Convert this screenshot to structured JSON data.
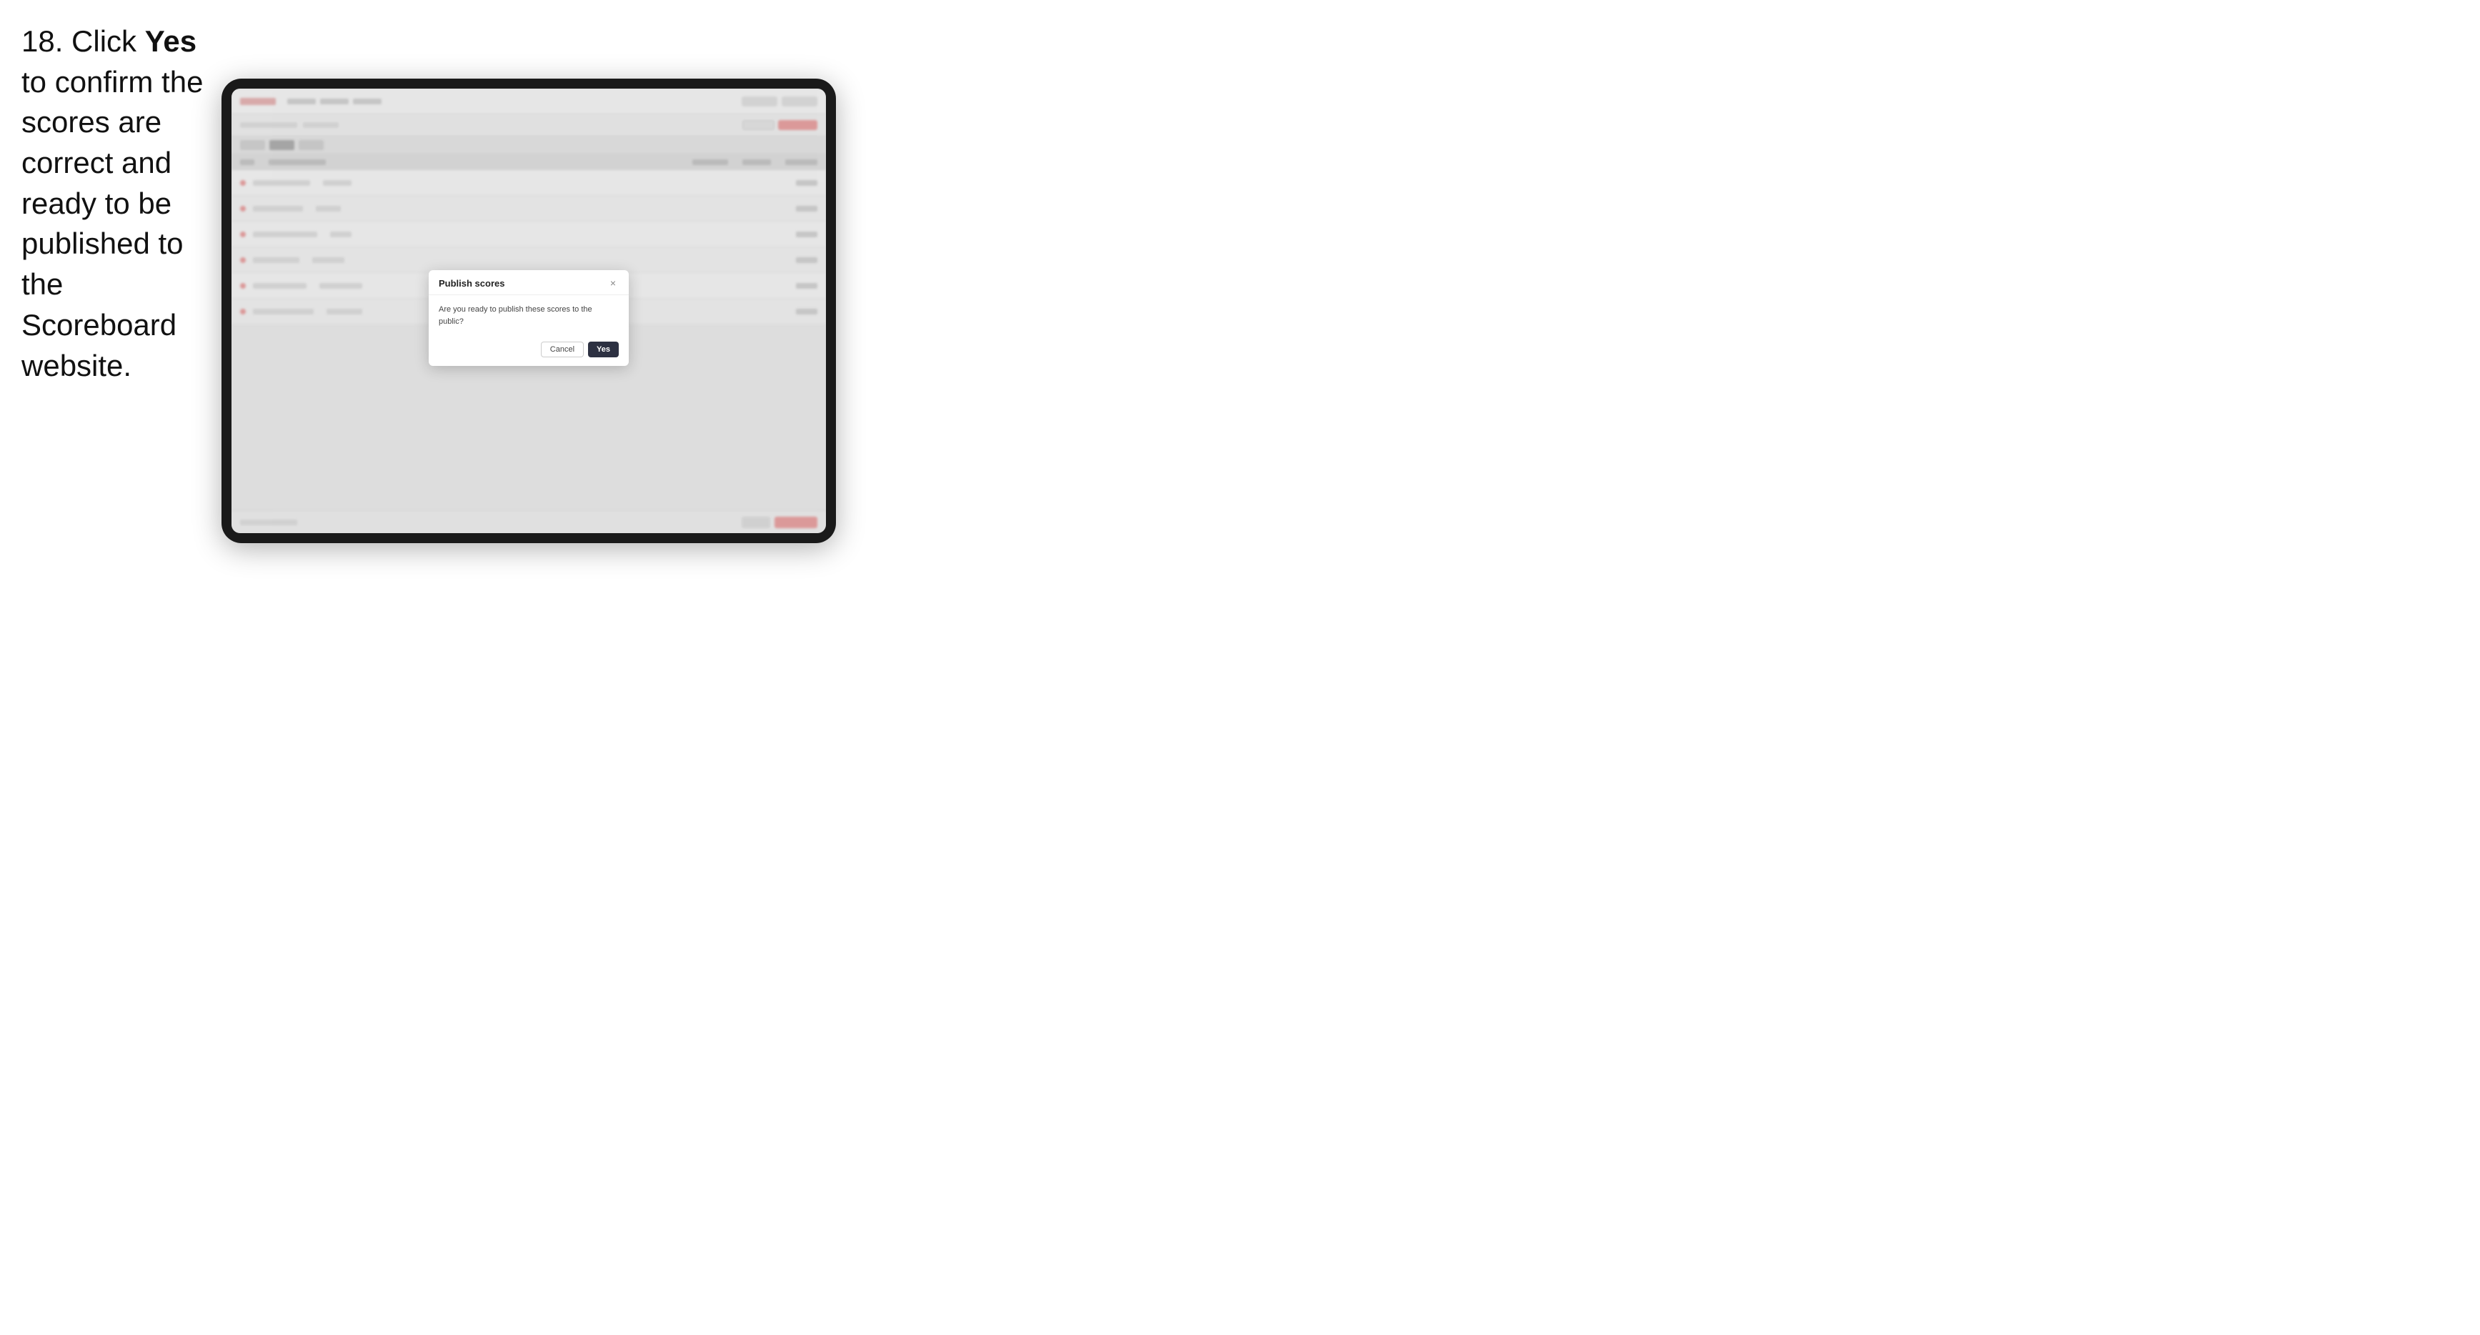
{
  "instruction": {
    "step_number": "18.",
    "text_before_bold": " Click ",
    "bold_text": "Yes",
    "text_after_bold": " to confirm the scores are correct and ready to be published to the Scoreboard website."
  },
  "tablet": {
    "background_rows": [
      {
        "id": 1,
        "col1_width": 80,
        "col2_width": 60,
        "col3_width": 40
      },
      {
        "id": 2,
        "col1_width": 70,
        "col2_width": 50,
        "col3_width": 35
      },
      {
        "id": 3,
        "col1_width": 90,
        "col2_width": 55,
        "col3_width": 30
      },
      {
        "id": 4,
        "col1_width": 65,
        "col2_width": 45,
        "col3_width": 40
      },
      {
        "id": 5,
        "col1_width": 75,
        "col2_width": 60,
        "col3_width": 35
      },
      {
        "id": 6,
        "col1_width": 85,
        "col2_width": 50,
        "col3_width": 30
      }
    ]
  },
  "modal": {
    "title": "Publish scores",
    "close_icon": "×",
    "message": "Are you ready to publish these scores to the public?",
    "cancel_label": "Cancel",
    "yes_label": "Yes"
  },
  "colors": {
    "yes_button_bg": "#2d3142",
    "yes_button_text": "#ffffff",
    "cancel_button_border": "#cccccc",
    "modal_bg": "#ffffff",
    "arrow_color": "#e83e6c"
  }
}
